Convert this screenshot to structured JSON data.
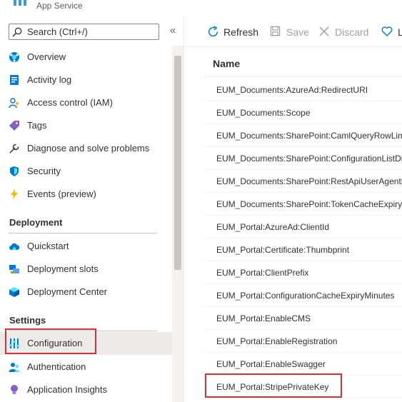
{
  "header": {
    "subtitle": "App Service"
  },
  "search": {
    "placeholder": "Search (Ctrl+/)"
  },
  "collapse_glyph": "«",
  "nav": {
    "main": [
      {
        "label": "Overview",
        "icon": "overview-icon"
      },
      {
        "label": "Activity log",
        "icon": "activity-log-icon"
      },
      {
        "label": "Access control (IAM)",
        "icon": "access-control-icon"
      },
      {
        "label": "Tags",
        "icon": "tag-icon"
      },
      {
        "label": "Diagnose and solve problems",
        "icon": "wrench-icon"
      },
      {
        "label": "Security",
        "icon": "shield-icon"
      },
      {
        "label": "Events (preview)",
        "icon": "lightning-icon"
      }
    ],
    "deployment_heading": "Deployment",
    "deployment": [
      {
        "label": "Quickstart",
        "icon": "cloud-icon"
      },
      {
        "label": "Deployment slots",
        "icon": "deployment-slots-icon"
      },
      {
        "label": "Deployment Center",
        "icon": "cube-icon"
      }
    ],
    "settings_heading": "Settings",
    "settings": [
      {
        "label": "Configuration",
        "icon": "configuration-icon",
        "selected": true
      },
      {
        "label": "Authentication",
        "icon": "users-icon"
      },
      {
        "label": "Application Insights",
        "icon": "lightbulb-icon"
      }
    ]
  },
  "toolbar": {
    "refresh": "Refresh",
    "save": "Save",
    "discard": "Discard",
    "extra": "L"
  },
  "grid": {
    "column_name": "Name",
    "rows": [
      "EUM_Documents:AzureAd:RedirectURI",
      "EUM_Documents:Scope",
      "EUM_Documents:SharePoint:CamlQueryRowLimit",
      "EUM_Documents:SharePoint:ConfigurationListDis",
      "EUM_Documents:SharePoint:RestApiUserAgentHe",
      "EUM_Documents:SharePoint:TokenCacheExpiryOf",
      "EUM_Portal:AzureAd:ClientId",
      "EUM_Portal:Certificate:Thumbprint",
      "EUM_Portal:ClientPrefix",
      "EUM_Portal:ConfigurationCacheExpiryMinutes",
      "EUM_Portal:EnableCMS",
      "EUM_Portal:EnableRegistration",
      "EUM_Portal:EnableSwagger",
      "EUM_Portal:StripePrivateKey"
    ]
  },
  "colors": {
    "accent": "#0078d4",
    "highlight": "#d13438"
  }
}
